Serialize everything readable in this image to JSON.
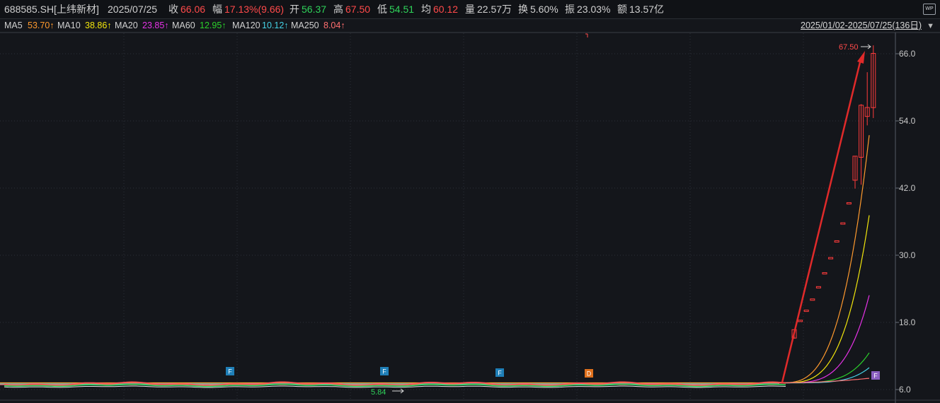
{
  "header": {
    "code": "688585.SH[上纬新材]",
    "date": "2025/07/25",
    "close_label": "收",
    "close": "66.06",
    "change_label": "幅",
    "change": "17.13%(9.66)",
    "open_label": "开",
    "open": "56.37",
    "high_label": "高",
    "high": "67.50",
    "low_label": "低",
    "low": "54.51",
    "avg_label": "均",
    "avg": "60.12",
    "vol_label": "量",
    "vol": "22.57万",
    "turnover_label": "换",
    "turnover": "5.60%",
    "amplitude_label": "振",
    "amplitude": "23.03%",
    "amount_label": "额",
    "amount": "13.57亿",
    "wp_icon_text": "WP"
  },
  "ma_bar": {
    "items": [
      {
        "label": "MA5",
        "value": "53.70↑",
        "color": "#ff9a2e"
      },
      {
        "label": "MA10",
        "value": "38.86↑",
        "color": "#f2e60c"
      },
      {
        "label": "MA20",
        "value": "23.85↑",
        "color": "#e632e6"
      },
      {
        "label": "MA60",
        "value": "12.95↑",
        "color": "#2bd12b"
      },
      {
        "label": "MA120",
        "value": "10.12↑",
        "color": "#45d2e6"
      },
      {
        "label": "MA250",
        "value": "8.04↑",
        "color": "#ff6f6f"
      }
    ],
    "range": "2025/01/02-2025/07/25(136日)",
    "range_caret": "▼"
  },
  "chart_data": {
    "type": "candlestick",
    "y_ticks": [
      "66.0",
      "54.0",
      "42.0",
      "30.0",
      "18.0",
      "6.0"
    ],
    "ylim": [
      6.0,
      66.0
    ],
    "grid": true,
    "annotations": {
      "high_label": "67.50",
      "low_label": "5.84",
      "markers": [
        {
          "text": "F",
          "color": "#1f7fb8"
        },
        {
          "text": "F",
          "color": "#1f7fb8"
        },
        {
          "text": "F",
          "color": "#1f7fb8"
        },
        {
          "text": "D",
          "color": "#e0701c"
        },
        {
          "text": "F",
          "color": "#8a5fc0"
        }
      ]
    },
    "candles": [
      {
        "o": 15.2,
        "h": 16.7,
        "l": 15.1,
        "c": 16.7
      },
      {
        "o": 18.3,
        "h": 18.4,
        "l": 18.3,
        "c": 18.4
      },
      {
        "o": 20.2,
        "h": 20.2,
        "l": 20.2,
        "c": 20.2
      },
      {
        "o": 22.2,
        "h": 22.2,
        "l": 22.2,
        "c": 22.2
      },
      {
        "o": 24.4,
        "h": 24.4,
        "l": 24.4,
        "c": 24.4
      },
      {
        "o": 26.9,
        "h": 26.9,
        "l": 26.9,
        "c": 26.9
      },
      {
        "o": 29.6,
        "h": 29.6,
        "l": 29.6,
        "c": 29.6
      },
      {
        "o": 32.6,
        "h": 32.6,
        "l": 32.6,
        "c": 32.6
      },
      {
        "o": 35.8,
        "h": 35.8,
        "l": 35.8,
        "c": 35.8
      },
      {
        "o": 39.4,
        "h": 39.4,
        "l": 39.4,
        "c": 39.4
      },
      {
        "o": 43.4,
        "h": 47.7,
        "l": 41.9,
        "c": 47.7
      },
      {
        "o": 47.5,
        "h": 57.0,
        "l": 42.6,
        "c": 56.8
      },
      {
        "o": 54.8,
        "h": 62.7,
        "l": 53.2,
        "c": 56.4
      },
      {
        "o": 56.37,
        "h": 67.5,
        "l": 54.51,
        "c": 66.06
      }
    ]
  }
}
